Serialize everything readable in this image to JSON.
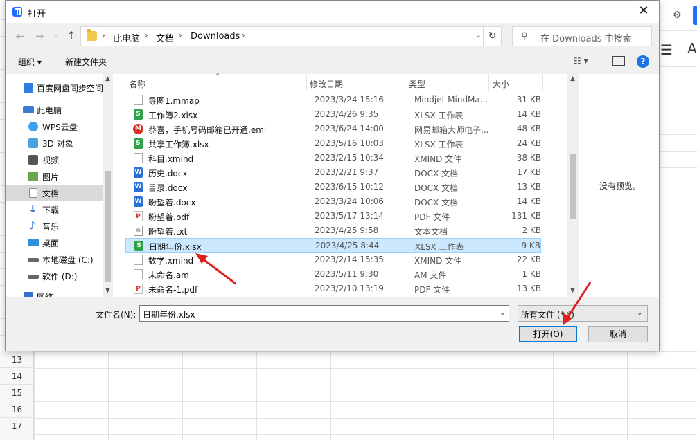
{
  "background": {
    "row_numbers": [
      "13",
      "14",
      "15",
      "16",
      "17"
    ],
    "right_icons": [
      "gear-icon",
      "menu-icon"
    ],
    "right_letter": "A"
  },
  "dialog": {
    "title": "打开",
    "close_glyph": "✕",
    "nav": {
      "back": "←",
      "forward": "→",
      "recent": "⌄",
      "up": "↑"
    },
    "breadcrumbs": [
      "此电脑",
      "文档",
      "Downloads"
    ],
    "refresh_glyph": "↻",
    "search_placeholder": "在 Downloads 中搜索",
    "toolbar": {
      "organize": "组织 ▾",
      "new_folder": "新建文件夹",
      "view": "☷ ▾",
      "help": "?"
    },
    "nav_pane": [
      {
        "label": "百度网盘同步空间",
        "icon": "baidu-cloud-icon",
        "color": "#2b7de9"
      },
      {
        "label": "此电脑",
        "icon": "pc-icon",
        "color": "#3a7bd5"
      },
      {
        "label": "WPS云盘",
        "icon": "cloud-icon",
        "color": "#3ba1f0"
      },
      {
        "label": "3D 对象",
        "icon": "cube-icon",
        "color": "#4aa3df"
      },
      {
        "label": "视频",
        "icon": "video-icon",
        "color": "#555555"
      },
      {
        "label": "图片",
        "icon": "picture-icon",
        "color": "#6aa84f"
      },
      {
        "label": "文档",
        "icon": "document-icon",
        "color": "#8a8a8a"
      },
      {
        "label": "下载",
        "icon": "download-icon",
        "color": "#2f6fd6"
      },
      {
        "label": "音乐",
        "icon": "music-icon",
        "color": "#2f6fd6"
      },
      {
        "label": "桌面",
        "icon": "desktop-icon",
        "color": "#2f8fd6"
      },
      {
        "label": "本地磁盘 (C:)",
        "icon": "disk-icon",
        "color": "#666666"
      },
      {
        "label": "软件 (D:)",
        "icon": "disk-icon",
        "color": "#666666"
      },
      {
        "label": "网络",
        "icon": "network-icon",
        "color": "#2f6fd6"
      }
    ],
    "columns": {
      "name": "名称",
      "date": "修改日期",
      "type": "类型",
      "size": "大小"
    },
    "files": [
      {
        "name": "导图1.mmap",
        "date": "2023/3/24 15:16",
        "type": "Mindjet MindMa...",
        "size": "31 KB",
        "icon": "blank-file-icon"
      },
      {
        "name": "工作簿2.xlsx",
        "date": "2023/4/26 9:35",
        "type": "XLSX 工作表",
        "size": "14 KB",
        "icon": "wps-sheet-icon"
      },
      {
        "name": "恭喜，手机号码邮箱已开通.eml",
        "date": "2023/6/24 14:00",
        "type": "网易邮箱大师电子...",
        "size": "48 KB",
        "icon": "mail-master-icon"
      },
      {
        "name": "共享工作簿.xlsx",
        "date": "2023/5/16 10:03",
        "type": "XLSX 工作表",
        "size": "24 KB",
        "icon": "wps-sheet-icon"
      },
      {
        "name": "科目.xmind",
        "date": "2023/2/15 10:34",
        "type": "XMIND 文件",
        "size": "38 KB",
        "icon": "blank-file-icon"
      },
      {
        "name": "历史.docx",
        "date": "2023/2/21 9:37",
        "type": "DOCX 文档",
        "size": "17 KB",
        "icon": "wps-doc-icon"
      },
      {
        "name": "目录.docx",
        "date": "2023/6/15 10:12",
        "type": "DOCX 文档",
        "size": "13 KB",
        "icon": "wps-doc-icon"
      },
      {
        "name": "盼望着.docx",
        "date": "2023/3/24 10:06",
        "type": "DOCX 文档",
        "size": "14 KB",
        "icon": "wps-doc-icon"
      },
      {
        "name": "盼望着.pdf",
        "date": "2023/5/17 13:14",
        "type": "PDF 文件",
        "size": "131 KB",
        "icon": "pdf-icon"
      },
      {
        "name": "盼望着.txt",
        "date": "2023/4/25 9:58",
        "type": "文本文档",
        "size": "2 KB",
        "icon": "text-file-icon"
      },
      {
        "name": "日期年份.xlsx",
        "date": "2023/4/25 8:44",
        "type": "XLSX 工作表",
        "size": "9 KB",
        "icon": "wps-sheet-icon",
        "selected": true
      },
      {
        "name": "数学.xmind",
        "date": "2023/2/14 15:35",
        "type": "XMIND 文件",
        "size": "22 KB",
        "icon": "blank-file-icon"
      },
      {
        "name": "未命名.am",
        "date": "2023/5/11 9:30",
        "type": "AM 文件",
        "size": "1 KB",
        "icon": "blank-file-icon"
      },
      {
        "name": "未命名-1.pdf",
        "date": "2023/2/10 13:19",
        "type": "PDF 文件",
        "size": "13 KB",
        "icon": "pdf-icon"
      }
    ],
    "preview_text": "没有预览。",
    "filename_label": "文件名(N):",
    "filename_value": "日期年份.xlsx",
    "filetype_value": "所有文件 (*.*)",
    "open_label": "打开(O)",
    "cancel_label": "取消"
  },
  "colors": {
    "selection_bg": "#cce8ff",
    "selection_border": "#99d1ff",
    "accent": "#0078d7",
    "annotation": "#e02020",
    "sheet_icon": "#2fa24a",
    "doc_icon": "#2b6fd6",
    "pdf_icon": "#d93025",
    "mail_icon": "#d93025"
  }
}
